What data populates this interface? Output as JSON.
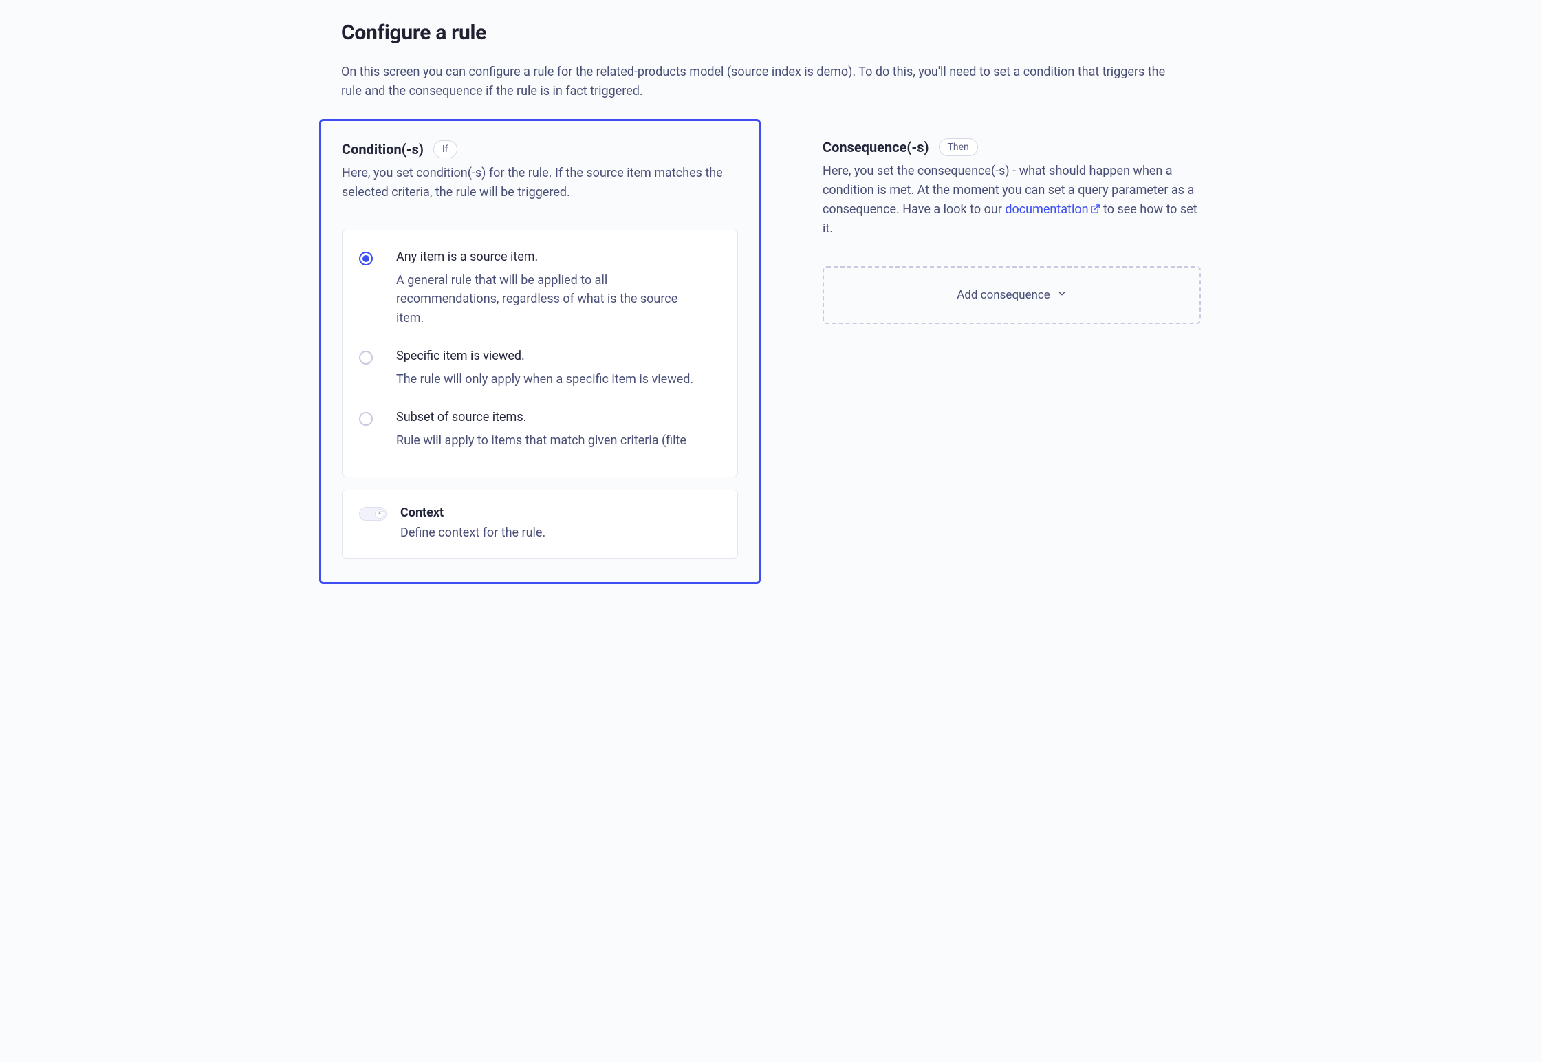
{
  "page": {
    "title": "Configure a rule",
    "description": "On this screen you can configure a rule for the related-products model (source index is demo). To do this, you'll need to set a condition that triggers the rule and the consequence if the rule is in fact triggered."
  },
  "condition": {
    "title": "Condition(-s)",
    "pill": "If",
    "description": "Here, you set condition(-s) for the rule. If the source item matches the selected criteria, the rule will be triggered.",
    "options": [
      {
        "title": "Any item is a source item.",
        "desc": "A general rule that will be applied to all recommendations, regardless of what is the source item.",
        "selected": true
      },
      {
        "title": "Specific item is viewed.",
        "desc": "The rule will only apply when a specific item is viewed.",
        "selected": false
      },
      {
        "title": "Subset of source items.",
        "desc": "Rule will apply to items that match given criteria (filte",
        "selected": false
      }
    ],
    "context": {
      "title": "Context",
      "desc": "Define context for the rule.",
      "enabled": false
    }
  },
  "consequence": {
    "title": "Consequence(-s)",
    "pill": "Then",
    "description_pre": "Here, you set the consequence(-s) - what should happen when a condition is met. At the moment you can set a query parameter as a consequence. Have a look to our ",
    "link_label": "documentation",
    "description_post": " to see how to set it.",
    "add_label": "Add consequence"
  }
}
